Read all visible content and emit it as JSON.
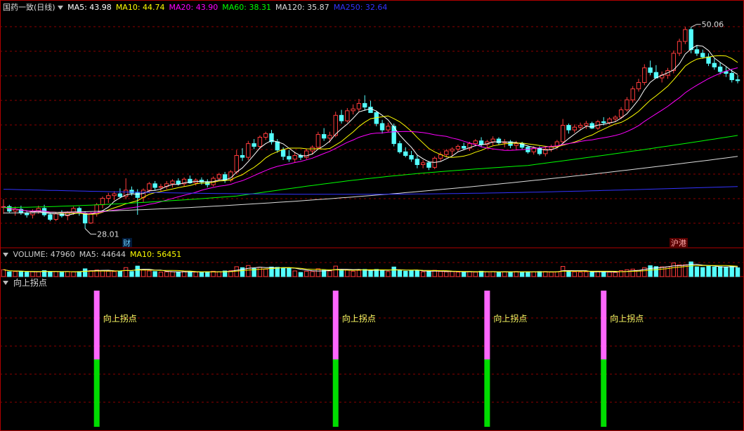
{
  "price_panel": {
    "title": "国药一致(日线)",
    "ma_labels": [
      {
        "text": "MA5: 43.98",
        "color": "#ffffff"
      },
      {
        "text": "MA10: 44.74",
        "color": "#ffff00"
      },
      {
        "text": "MA20: 43.90",
        "color": "#ff00ff"
      },
      {
        "text": "MA60: 38.31",
        "color": "#00ff00"
      },
      {
        "text": "MA120: 35.87",
        "color": "#dddddd"
      },
      {
        "text": "MA250: 32.64",
        "color": "#3333ff"
      }
    ],
    "low_label": "28.01",
    "high_label": "50.06",
    "marker_1": "财",
    "marker_2": "沪港"
  },
  "volume_panel": {
    "labels": [
      {
        "text": "VOLUME: 47960",
        "color": "#cccccc"
      },
      {
        "text": "MA5: 44644",
        "color": "#cccccc"
      },
      {
        "text": "MA10: 56451",
        "color": "#ffff00"
      }
    ]
  },
  "indicator_panel": {
    "title": "向上拐点",
    "signal_label": "向上拐点"
  },
  "colors": {
    "up": "#ff3b3b",
    "down": "#54ffff",
    "grid": "#8b0000",
    "ma5": "#ffffff",
    "ma10": "#ffff00",
    "ma20": "#ff00ff",
    "ma60": "#00ff00",
    "ma120": "#dddddd",
    "ma250": "#3333ff",
    "signal_top": "#ff66ff",
    "signal_bottom": "#00dd00"
  },
  "chart_data": {
    "type": "candlestick",
    "price_range": [
      26.5,
      51.5
    ],
    "candles": [
      [
        30.3,
        31.2,
        29.6,
        30.4
      ],
      [
        30.4,
        30.6,
        29.7,
        29.9
      ],
      [
        29.9,
        30.4,
        29.4,
        30.1
      ],
      [
        30.1,
        30.5,
        29.5,
        29.7
      ],
      [
        29.7,
        30.0,
        29.2,
        29.5
      ],
      [
        29.5,
        30.1,
        29.1,
        29.9
      ],
      [
        29.9,
        30.5,
        29.6,
        30.2
      ],
      [
        30.2,
        30.6,
        29.3,
        29.5
      ],
      [
        29.5,
        29.7,
        28.8,
        29.0
      ],
      [
        29.0,
        29.8,
        28.8,
        29.6
      ],
      [
        29.6,
        30.0,
        29.2,
        29.4
      ],
      [
        29.4,
        29.9,
        28.9,
        29.8
      ],
      [
        29.8,
        30.4,
        29.5,
        30.2
      ],
      [
        30.2,
        30.4,
        29.4,
        29.7
      ],
      [
        29.7,
        29.9,
        28.0,
        28.6
      ],
      [
        28.6,
        29.8,
        28.5,
        29.6
      ],
      [
        29.6,
        30.8,
        29.3,
        30.6
      ],
      [
        30.6,
        31.5,
        30.2,
        31.3
      ],
      [
        31.3,
        31.9,
        30.8,
        31.6
      ],
      [
        31.6,
        32.1,
        31.1,
        31.8
      ],
      [
        31.8,
        32.4,
        31.3,
        31.5
      ],
      [
        31.5,
        33.5,
        31.2,
        32.2
      ],
      [
        32.2,
        32.6,
        31.6,
        31.9
      ],
      [
        31.9,
        32.3,
        29.5,
        31.4
      ],
      [
        31.4,
        32.4,
        30.9,
        32.2
      ],
      [
        32.2,
        33.1,
        31.9,
        32.9
      ],
      [
        32.9,
        33.2,
        32.2,
        32.5
      ],
      [
        32.5,
        32.9,
        32.1,
        32.6
      ],
      [
        32.6,
        33.2,
        32.3,
        32.9
      ],
      [
        32.9,
        33.4,
        32.5,
        33.2
      ],
      [
        33.2,
        33.5,
        32.7,
        32.9
      ],
      [
        32.9,
        33.6,
        32.6,
        33.4
      ],
      [
        33.4,
        33.8,
        32.9,
        33.0
      ],
      [
        33.0,
        33.5,
        32.7,
        33.3
      ],
      [
        33.3,
        33.6,
        32.8,
        33.1
      ],
      [
        33.1,
        33.4,
        32.5,
        32.8
      ],
      [
        32.8,
        33.7,
        32.6,
        33.5
      ],
      [
        33.5,
        34.1,
        33.2,
        33.9
      ],
      [
        33.9,
        34.2,
        33.0,
        33.3
      ],
      [
        33.3,
        34.4,
        33.1,
        34.2
      ],
      [
        34.2,
        36.6,
        34.0,
        36.0
      ],
      [
        36.0,
        36.8,
        35.4,
        35.8
      ],
      [
        35.8,
        37.6,
        35.5,
        37.3
      ],
      [
        37.3,
        37.8,
        36.7,
        37.0
      ],
      [
        37.0,
        38.2,
        36.7,
        38.0
      ],
      [
        38.0,
        38.6,
        37.7,
        38.4
      ],
      [
        38.4,
        38.8,
        37.2,
        37.5
      ],
      [
        37.5,
        37.8,
        36.3,
        36.6
      ],
      [
        36.6,
        36.9,
        35.5,
        35.9
      ],
      [
        35.9,
        36.6,
        35.3,
        35.6
      ],
      [
        35.6,
        36.4,
        35.2,
        36.0
      ],
      [
        36.0,
        36.2,
        35.5,
        35.8
      ],
      [
        35.8,
        36.7,
        35.6,
        36.5
      ],
      [
        36.5,
        37.1,
        36.1,
        36.9
      ],
      [
        36.9,
        38.6,
        36.7,
        38.3
      ],
      [
        38.3,
        39.0,
        37.6,
        37.9
      ],
      [
        37.9,
        38.6,
        37.4,
        38.2
      ],
      [
        38.2,
        40.8,
        38.0,
        40.4
      ],
      [
        40.4,
        41.0,
        39.5,
        39.8
      ],
      [
        39.8,
        41.2,
        39.6,
        40.9
      ],
      [
        40.9,
        41.6,
        40.5,
        41.1
      ],
      [
        41.1,
        42.2,
        40.8,
        41.7
      ],
      [
        41.7,
        42.6,
        40.9,
        41.3
      ],
      [
        41.3,
        42.0,
        40.8,
        40.7
      ],
      [
        40.7,
        40.9,
        39.2,
        39.5
      ],
      [
        39.5,
        39.9,
        38.4,
        38.8
      ],
      [
        38.8,
        39.6,
        38.6,
        39.2
      ],
      [
        39.2,
        39.5,
        37.0,
        37.3
      ],
      [
        37.3,
        37.6,
        36.2,
        36.4
      ],
      [
        36.4,
        36.9,
        35.8,
        36.0
      ],
      [
        36.0,
        36.5,
        35.3,
        35.6
      ],
      [
        35.6,
        36.0,
        34.6,
        35.0
      ],
      [
        35.0,
        35.5,
        34.6,
        35.2
      ],
      [
        35.2,
        35.4,
        34.4,
        34.7
      ],
      [
        34.7,
        35.9,
        34.5,
        35.7
      ],
      [
        35.7,
        36.4,
        35.4,
        36.1
      ],
      [
        36.1,
        36.7,
        35.8,
        36.5
      ],
      [
        36.5,
        36.9,
        35.9,
        36.7
      ],
      [
        36.7,
        37.2,
        36.4,
        37.0
      ],
      [
        37.0,
        37.4,
        36.6,
        36.8
      ],
      [
        36.8,
        37.5,
        36.5,
        37.3
      ],
      [
        37.3,
        37.8,
        37.0,
        37.6
      ],
      [
        37.6,
        38.0,
        36.9,
        37.2
      ],
      [
        37.2,
        37.7,
        36.8,
        37.5
      ],
      [
        37.5,
        38.1,
        37.1,
        37.8
      ],
      [
        37.8,
        38.0,
        37.2,
        37.4
      ],
      [
        37.4,
        37.8,
        36.9,
        37.5
      ],
      [
        37.5,
        37.7,
        36.8,
        37.1
      ],
      [
        37.1,
        37.6,
        36.6,
        37.3
      ],
      [
        37.3,
        37.5,
        36.7,
        36.9
      ],
      [
        36.9,
        37.1,
        36.2,
        36.4
      ],
      [
        36.4,
        37.0,
        36.1,
        36.8
      ],
      [
        36.8,
        37.0,
        36.0,
        36.2
      ],
      [
        36.2,
        36.9,
        35.9,
        36.7
      ],
      [
        36.7,
        37.2,
        36.4,
        37.0
      ],
      [
        37.0,
        37.7,
        36.8,
        37.5
      ],
      [
        37.5,
        40.0,
        37.3,
        39.3
      ],
      [
        39.3,
        39.5,
        38.4,
        38.8
      ],
      [
        38.8,
        39.4,
        38.5,
        39.1
      ],
      [
        39.1,
        39.6,
        38.8,
        39.3
      ],
      [
        39.3,
        39.8,
        38.9,
        39.5
      ],
      [
        39.5,
        39.7,
        38.9,
        39.0
      ],
      [
        39.0,
        39.9,
        38.8,
        39.7
      ],
      [
        39.7,
        40.2,
        39.3,
        39.6
      ],
      [
        39.6,
        40.2,
        39.4,
        40.0
      ],
      [
        40.0,
        40.4,
        39.7,
        40.2
      ],
      [
        40.2,
        41.3,
        40.0,
        41.0
      ],
      [
        41.0,
        42.4,
        40.8,
        42.1
      ],
      [
        42.1,
        43.6,
        41.8,
        43.3
      ],
      [
        43.3,
        44.4,
        43.0,
        44.0
      ],
      [
        44.0,
        46.0,
        43.7,
        45.6
      ],
      [
        45.6,
        46.4,
        44.8,
        45.1
      ],
      [
        45.1,
        45.9,
        44.6,
        44.5
      ],
      [
        44.5,
        45.2,
        44.0,
        44.8
      ],
      [
        44.8,
        45.6,
        44.4,
        45.3
      ],
      [
        45.3,
        47.5,
        45.0,
        47.2
      ],
      [
        47.2,
        48.8,
        46.9,
        48.5
      ],
      [
        48.5,
        50.1,
        48.2,
        49.8
      ],
      [
        49.8,
        50.06,
        47.2,
        47.6
      ],
      [
        47.6,
        48.1,
        46.9,
        47.2
      ],
      [
        47.2,
        47.6,
        46.6,
        46.8
      ],
      [
        46.8,
        47.2,
        45.8,
        46.1
      ],
      [
        46.1,
        46.6,
        45.4,
        45.7
      ],
      [
        45.7,
        46.2,
        44.9,
        45.2
      ],
      [
        45.2,
        45.7,
        44.6,
        45.0
      ],
      [
        45.0,
        45.4,
        44.0,
        44.3
      ],
      [
        44.3,
        44.8,
        43.9,
        44.2
      ]
    ],
    "volume_range": [
      0,
      230000
    ],
    "signals_candle_index": [
      16,
      57,
      83,
      103
    ]
  }
}
